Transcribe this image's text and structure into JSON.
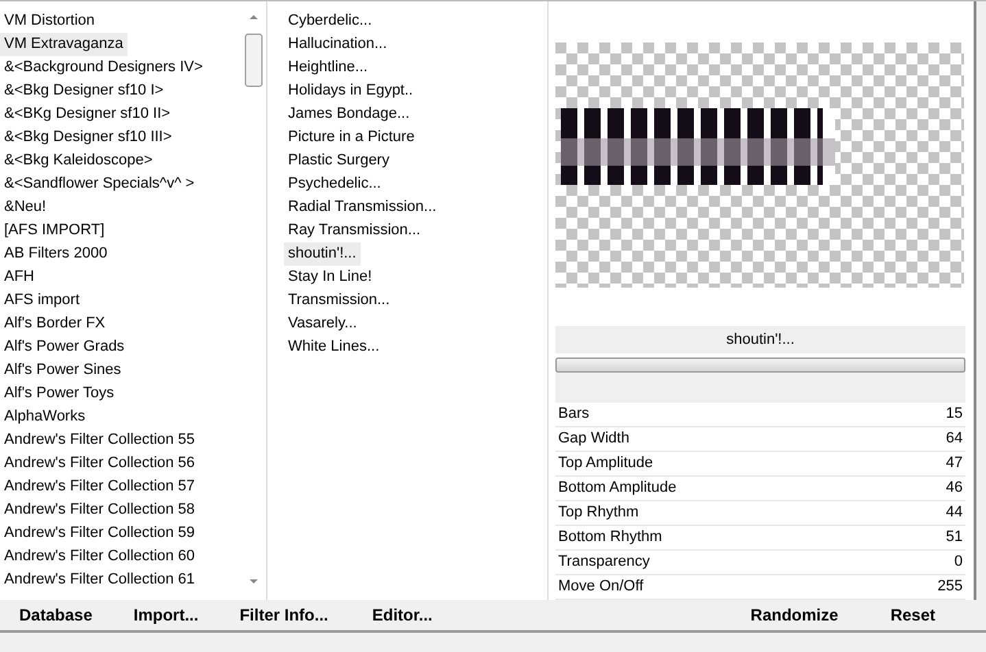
{
  "categories": [
    {
      "label": "VM Distortion",
      "selected": false
    },
    {
      "label": "VM Extravaganza",
      "selected": true
    },
    {
      "label": "&<Background Designers IV>",
      "selected": false
    },
    {
      "label": "&<Bkg Designer sf10 I>",
      "selected": false
    },
    {
      "label": "&<BKg Designer sf10 II>",
      "selected": false
    },
    {
      "label": "&<Bkg Designer sf10 III>",
      "selected": false
    },
    {
      "label": "&<Bkg Kaleidoscope>",
      "selected": false
    },
    {
      "label": "&<Sandflower Specials^v^ >",
      "selected": false
    },
    {
      "label": "&Neu!",
      "selected": false
    },
    {
      "label": "[AFS IMPORT]",
      "selected": false
    },
    {
      "label": "AB Filters 2000",
      "selected": false
    },
    {
      "label": "AFH",
      "selected": false
    },
    {
      "label": "AFS import",
      "selected": false
    },
    {
      "label": "Alf's Border FX",
      "selected": false
    },
    {
      "label": "Alf's Power Grads",
      "selected": false
    },
    {
      "label": "Alf's Power Sines",
      "selected": false
    },
    {
      "label": "Alf's Power Toys",
      "selected": false
    },
    {
      "label": "AlphaWorks",
      "selected": false
    },
    {
      "label": "Andrew's Filter Collection 55",
      "selected": false
    },
    {
      "label": "Andrew's Filter Collection 56",
      "selected": false
    },
    {
      "label": "Andrew's Filter Collection 57",
      "selected": false
    },
    {
      "label": "Andrew's Filter Collection 58",
      "selected": false
    },
    {
      "label": "Andrew's Filter Collection 59",
      "selected": false
    },
    {
      "label": "Andrew's Filter Collection 60",
      "selected": false
    },
    {
      "label": "Andrew's Filter Collection 61",
      "selected": false
    }
  ],
  "filters": [
    {
      "label": "Cyberdelic...",
      "selected": false
    },
    {
      "label": "Hallucination...",
      "selected": false
    },
    {
      "label": "Heightline...",
      "selected": false
    },
    {
      "label": "Holidays in Egypt..",
      "selected": false
    },
    {
      "label": "James Bondage...",
      "selected": false
    },
    {
      "label": "Picture in a Picture",
      "selected": false
    },
    {
      "label": "Plastic Surgery",
      "selected": false
    },
    {
      "label": "Psychedelic...",
      "selected": false
    },
    {
      "label": "Radial Transmission...",
      "selected": false
    },
    {
      "label": "Ray Transmission...",
      "selected": false
    },
    {
      "label": "shoutin'!...",
      "selected": true
    },
    {
      "label": "Stay In Line!",
      "selected": false
    },
    {
      "label": "Transmission...",
      "selected": false
    },
    {
      "label": "Vasarely...",
      "selected": false
    },
    {
      "label": "White Lines...",
      "selected": false
    }
  ],
  "filter_name": "shoutin'!...",
  "progress": {
    "level": 0
  },
  "parameters": [
    {
      "label": "Bars",
      "value": "15"
    },
    {
      "label": "Gap Width",
      "value": "64"
    },
    {
      "label": "Top Amplitude",
      "value": "47"
    },
    {
      "label": "Bottom Amplitude",
      "value": "46"
    },
    {
      "label": "Top Rhythm",
      "value": "44"
    },
    {
      "label": "Bottom Rhythm",
      "value": "51"
    },
    {
      "label": "Transparency",
      "value": "0"
    },
    {
      "label": "Move On/Off",
      "value": "255"
    }
  ],
  "left_buttons": [
    "Database",
    "Import...",
    "Filter Info...",
    "Editor..."
  ],
  "right_buttons": [
    "Randomize",
    "Reset"
  ]
}
